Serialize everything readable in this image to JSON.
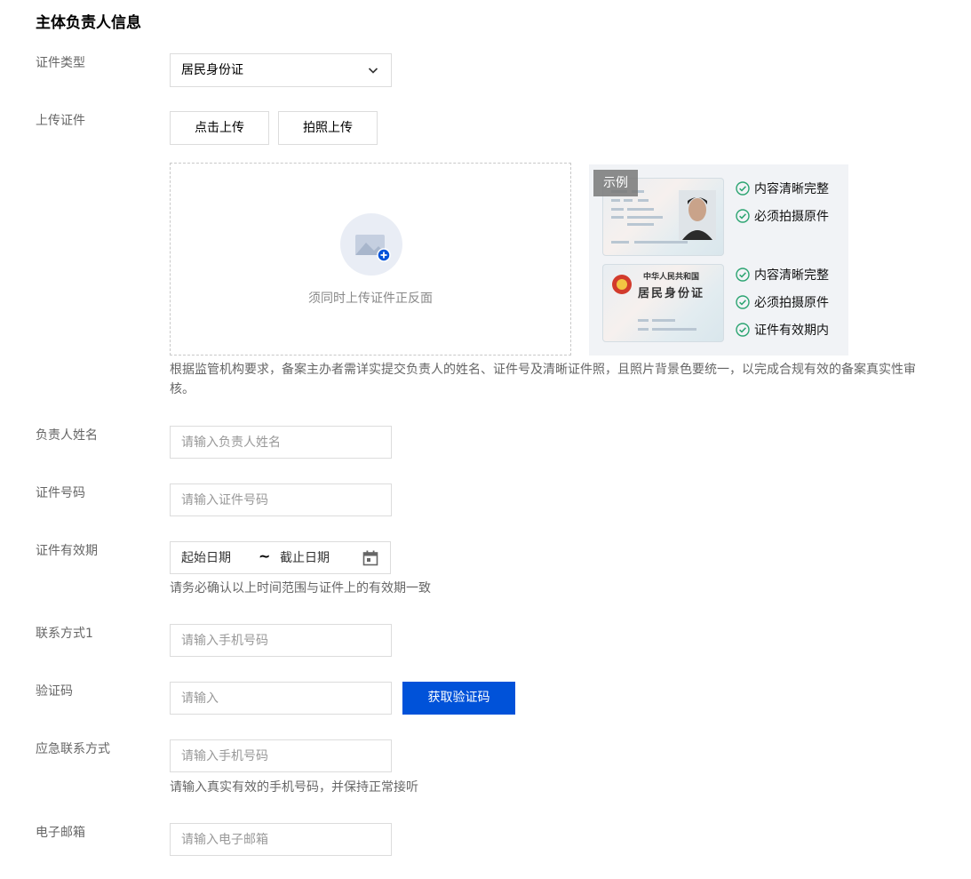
{
  "section_title": "主体负责人信息",
  "id_type": {
    "label": "证件类型",
    "value": "居民身份证"
  },
  "upload": {
    "label": "上传证件",
    "click_upload_label": "点击上传",
    "photo_upload_label": "拍照上传",
    "dropzone_text": "须同时上传证件正反面",
    "example": {
      "tag": "示例",
      "front_checks": [
        "内容清晰完整",
        "必须拍摄原件"
      ],
      "back_checks": [
        "内容清晰完整",
        "必须拍摄原件",
        "证件有效期内"
      ],
      "back_card_title_line1": "中华人民共和国",
      "back_card_title_line2": "居民身份证"
    },
    "notice": "根据监管机构要求，备案主办者需详实提交负责人的姓名、证件号及清晰证件照，且照片背景色要统一，以完成合规有效的备案真实性审核。"
  },
  "name": {
    "label": "负责人姓名",
    "placeholder": "请输入负责人姓名"
  },
  "id_number": {
    "label": "证件号码",
    "placeholder": "请输入证件号码"
  },
  "validity": {
    "label": "证件有效期",
    "start_placeholder": "起始日期",
    "separator": "~",
    "end_placeholder": "截止日期",
    "hint": "请务必确认以上时间范围与证件上的有效期一致"
  },
  "contact1": {
    "label": "联系方式1",
    "placeholder": "请输入手机号码"
  },
  "code": {
    "label": "验证码",
    "placeholder": "请输入",
    "button": "获取验证码"
  },
  "emergency": {
    "label": "应急联系方式",
    "placeholder": "请输入手机号码",
    "hint": "请输入真实有效的手机号码，并保持正常接听"
  },
  "email": {
    "label": "电子邮箱",
    "placeholder": "请输入电子邮箱"
  },
  "colors": {
    "primary": "#0052d9",
    "check_green": "#2ba471",
    "upload_plus": "#0052d9"
  }
}
